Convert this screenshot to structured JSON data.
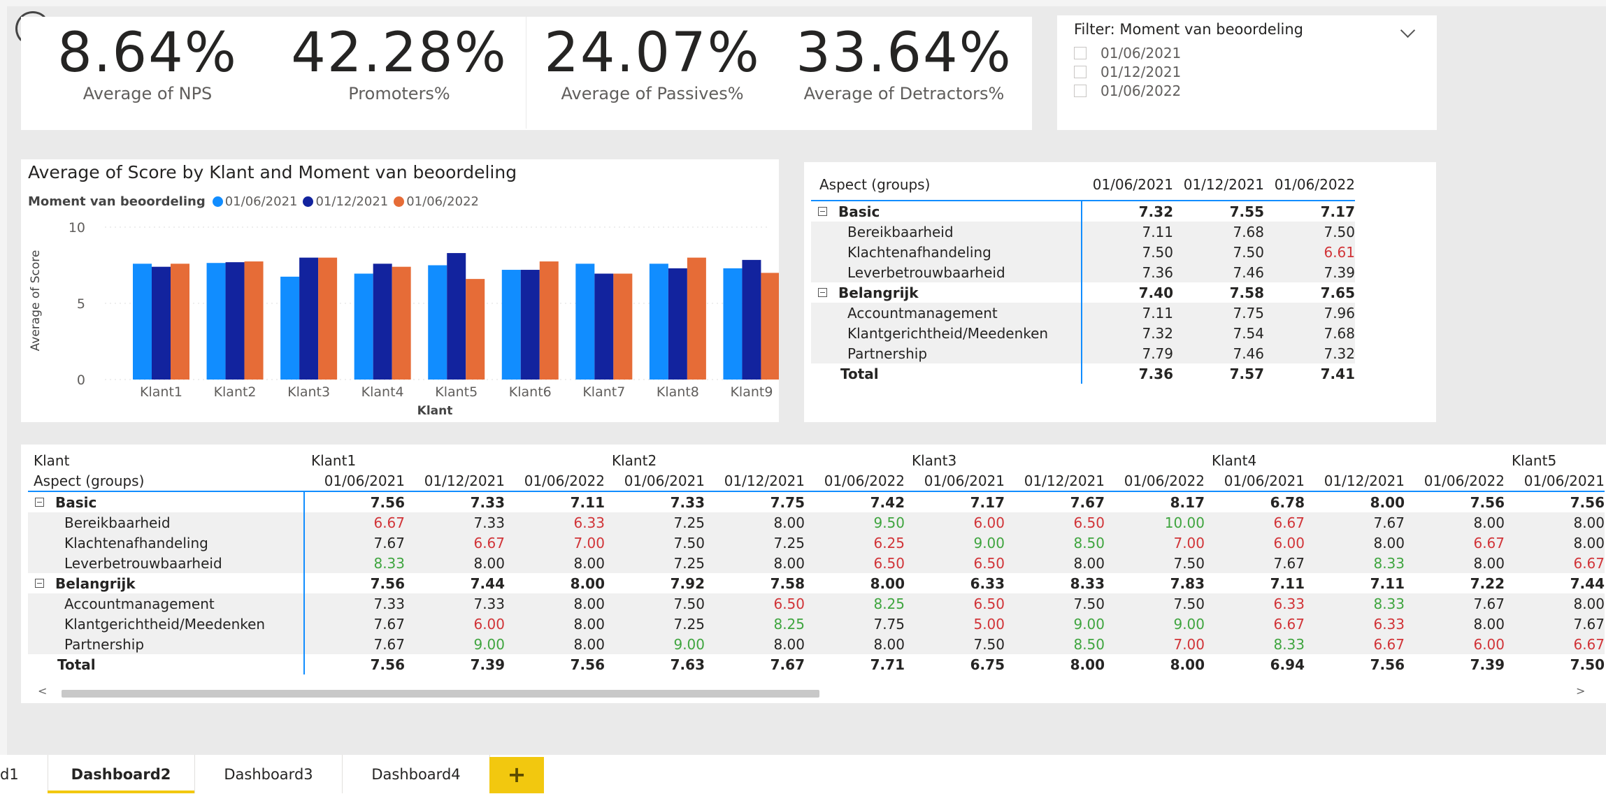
{
  "kpis": [
    {
      "value": "8.64%",
      "label": "Average of NPS"
    },
    {
      "value": "42.28%",
      "label": "Promoters%"
    },
    {
      "value": "24.07%",
      "label": "Average of Passives%"
    },
    {
      "value": "33.64%",
      "label": "Average of Detractors%"
    }
  ],
  "slicer": {
    "title": "Filter: Moment van beoordeling",
    "items": [
      "01/06/2021",
      "01/12/2021",
      "01/06/2022"
    ]
  },
  "chart_data": {
    "type": "bar",
    "title": "Average of Score by Klant and Moment van beoordeling",
    "legend_title": "Moment van beoordeling",
    "xlabel": "Klant",
    "ylabel": "Average of Score",
    "ylim": [
      0,
      10
    ],
    "yticks": [
      "0",
      "5",
      "10"
    ],
    "categories": [
      "Klant1",
      "Klant2",
      "Klant3",
      "Klant4",
      "Klant5",
      "Klant6",
      "Klant7",
      "Klant8",
      "Klant9"
    ],
    "series": [
      {
        "name": "01/06/2021",
        "color": "#118dff",
        "values": [
          7.6,
          7.65,
          6.75,
          6.95,
          7.5,
          7.2,
          7.6,
          7.6,
          7.3
        ]
      },
      {
        "name": "01/12/2021",
        "color": "#12239e",
        "values": [
          7.4,
          7.7,
          8.0,
          7.6,
          8.3,
          7.2,
          6.95,
          7.3,
          7.85
        ]
      },
      {
        "name": "01/06/2022",
        "color": "#e66c37",
        "values": [
          7.6,
          7.75,
          8.0,
          7.4,
          6.6,
          7.75,
          6.95,
          8.0,
          7.0
        ]
      }
    ]
  },
  "aspect_matrix": {
    "header": "Aspect (groups)",
    "columns": [
      "01/06/2021",
      "01/12/2021",
      "01/06/2022"
    ],
    "rows": [
      {
        "label": "Basic",
        "level": 0,
        "values": [
          "7.32",
          "7.55",
          "7.17"
        ],
        "colors": [
          "",
          "",
          ""
        ]
      },
      {
        "label": "Bereikbaarheid",
        "level": 1,
        "values": [
          "7.11",
          "7.68",
          "7.50"
        ],
        "colors": [
          "",
          "",
          ""
        ]
      },
      {
        "label": "Klachtenafhandeling",
        "level": 1,
        "values": [
          "7.50",
          "7.50",
          "6.61"
        ],
        "colors": [
          "",
          "",
          "red"
        ]
      },
      {
        "label": "Leverbetrouwbaarheid",
        "level": 1,
        "values": [
          "7.36",
          "7.46",
          "7.39"
        ],
        "colors": [
          "",
          "",
          ""
        ]
      },
      {
        "label": "Belangrijk",
        "level": 0,
        "values": [
          "7.40",
          "7.58",
          "7.65"
        ],
        "colors": [
          "",
          "",
          ""
        ]
      },
      {
        "label": "Accountmanagement",
        "level": 1,
        "values": [
          "7.11",
          "7.75",
          "7.96"
        ],
        "colors": [
          "",
          "",
          ""
        ]
      },
      {
        "label": "Klantgerichtheid/Meedenken",
        "level": 1,
        "values": [
          "7.32",
          "7.54",
          "7.68"
        ],
        "colors": [
          "",
          "",
          ""
        ]
      },
      {
        "label": "Partnership",
        "level": 1,
        "values": [
          "7.79",
          "7.46",
          "7.32"
        ],
        "colors": [
          "",
          "",
          ""
        ]
      },
      {
        "label": "Total",
        "level": 2,
        "values": [
          "7.36",
          "7.57",
          "7.41"
        ],
        "colors": [
          "",
          "",
          ""
        ]
      }
    ]
  },
  "klant_matrix": {
    "row_header_1": "Klant",
    "row_header_2": "Aspect (groups)",
    "groups": [
      "Klant1",
      "Klant2",
      "Klant3",
      "Klant4",
      "Klant5"
    ],
    "columns": [
      "01/06/2021",
      "01/12/2021",
      "01/06/2022",
      "01/06/2021",
      "01/12/2021",
      "01/06/2022",
      "01/06/2021",
      "01/12/2021",
      "01/06/2022",
      "01/06/2021",
      "01/12/2021",
      "01/06/2022",
      "01/06/2021"
    ],
    "rows": [
      {
        "label": "Basic",
        "level": 0,
        "values": [
          "7.56",
          "7.33",
          "7.11",
          "7.33",
          "7.75",
          "7.42",
          "7.17",
          "7.67",
          "8.17",
          "6.78",
          "8.00",
          "7.56",
          "7.56"
        ],
        "colors": [
          "",
          "",
          "",
          "",
          "",
          "",
          "",
          "",
          "",
          "",
          "",
          "",
          ""
        ]
      },
      {
        "label": "Bereikbaarheid",
        "level": 1,
        "values": [
          "6.67",
          "7.33",
          "6.33",
          "7.25",
          "8.00",
          "9.50",
          "6.00",
          "6.50",
          "10.00",
          "6.67",
          "7.67",
          "8.00",
          "8.00"
        ],
        "colors": [
          "red",
          "",
          "red",
          "",
          "",
          "green",
          "red",
          "red",
          "green",
          "red",
          "",
          "",
          ""
        ]
      },
      {
        "label": "Klachtenafhandeling",
        "level": 1,
        "values": [
          "7.67",
          "6.67",
          "7.00",
          "7.50",
          "7.25",
          "6.25",
          "9.00",
          "8.50",
          "7.00",
          "6.00",
          "8.00",
          "6.67",
          "8.00"
        ],
        "colors": [
          "",
          "red",
          "red",
          "",
          "",
          "red",
          "green",
          "green",
          "red",
          "red",
          "",
          "red",
          ""
        ]
      },
      {
        "label": "Leverbetrouwbaarheid",
        "level": 1,
        "values": [
          "8.33",
          "8.00",
          "8.00",
          "7.25",
          "8.00",
          "6.50",
          "6.50",
          "8.00",
          "7.50",
          "7.67",
          "8.33",
          "8.00",
          "6.67"
        ],
        "colors": [
          "green",
          "",
          "",
          "",
          "",
          "red",
          "red",
          "",
          "",
          "",
          "green",
          "",
          "red"
        ]
      },
      {
        "label": "Belangrijk",
        "level": 0,
        "values": [
          "7.56",
          "7.44",
          "8.00",
          "7.92",
          "7.58",
          "8.00",
          "6.33",
          "8.33",
          "7.83",
          "7.11",
          "7.11",
          "7.22",
          "7.44"
        ],
        "colors": [
          "",
          "",
          "",
          "",
          "",
          "",
          "",
          "",
          "",
          "",
          "",
          "",
          ""
        ]
      },
      {
        "label": "Accountmanagement",
        "level": 1,
        "values": [
          "7.33",
          "7.33",
          "8.00",
          "7.50",
          "6.50",
          "8.25",
          "6.50",
          "7.50",
          "7.50",
          "6.33",
          "8.33",
          "7.67",
          "8.00"
        ],
        "colors": [
          "",
          "",
          "",
          "",
          "red",
          "green",
          "red",
          "",
          "",
          "red",
          "green",
          "",
          ""
        ]
      },
      {
        "label": "Klantgerichtheid/Meedenken",
        "level": 1,
        "values": [
          "7.67",
          "6.00",
          "8.00",
          "7.25",
          "8.25",
          "7.75",
          "5.00",
          "9.00",
          "9.00",
          "6.67",
          "6.33",
          "8.00",
          "7.67"
        ],
        "colors": [
          "",
          "red",
          "",
          "",
          "green",
          "",
          "red",
          "green",
          "green",
          "red",
          "red",
          "",
          ""
        ]
      },
      {
        "label": "Partnership",
        "level": 1,
        "values": [
          "7.67",
          "9.00",
          "8.00",
          "9.00",
          "8.00",
          "8.00",
          "7.50",
          "8.50",
          "7.00",
          "8.33",
          "6.67",
          "6.00",
          "6.67"
        ],
        "colors": [
          "",
          "green",
          "",
          "green",
          "",
          "",
          "",
          "green",
          "red",
          "green",
          "red",
          "red",
          "red"
        ]
      },
      {
        "label": "Total",
        "level": 2,
        "values": [
          "7.56",
          "7.39",
          "7.56",
          "7.63",
          "7.67",
          "7.71",
          "6.75",
          "8.00",
          "8.00",
          "6.94",
          "7.56",
          "7.39",
          "7.50"
        ],
        "colors": [
          "",
          "",
          "",
          "",
          "",
          "",
          "",
          "",
          "",
          "",
          "",
          "",
          ""
        ]
      }
    ]
  },
  "scroll": {
    "left": "<",
    "right": ">"
  },
  "tabs": [
    {
      "label": "d1",
      "active": false
    },
    {
      "label": "Dashboard2",
      "active": true
    },
    {
      "label": "Dashboard3",
      "active": false
    },
    {
      "label": "Dashboard4",
      "active": false
    }
  ],
  "add_tab": "+"
}
